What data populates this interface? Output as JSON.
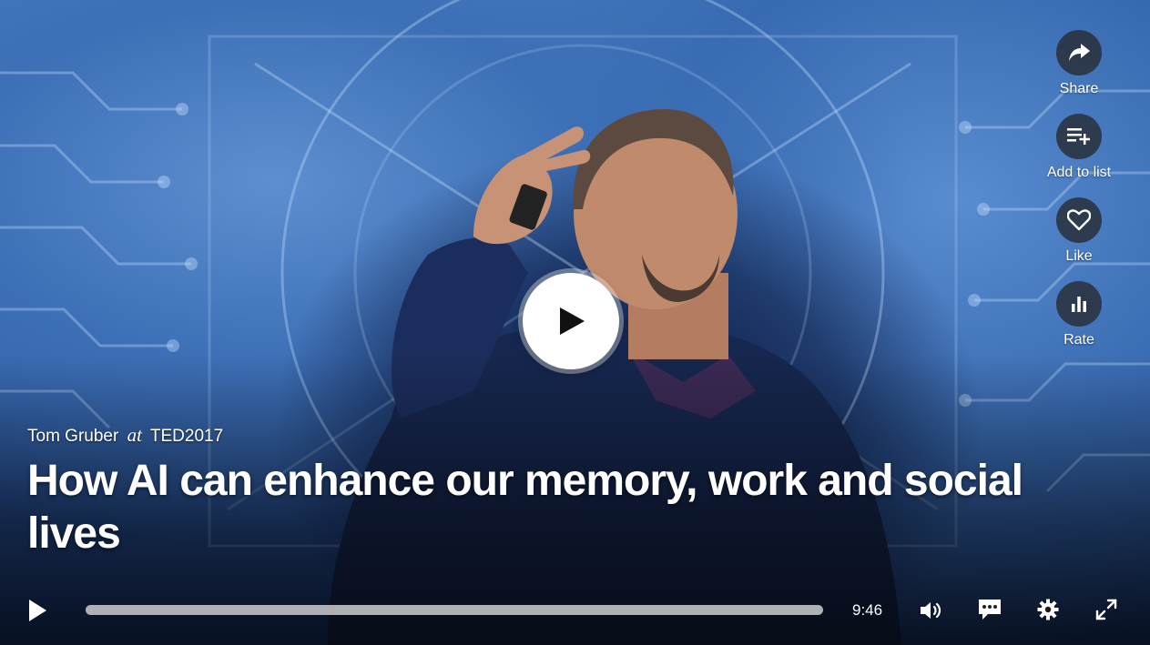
{
  "video": {
    "speaker": "Tom Gruber",
    "at_word": "at",
    "event": "TED2017",
    "title": "How AI can enhance our memory, work and social lives",
    "progress": 0
  },
  "side_actions": [
    {
      "label": "Share",
      "icon": "share-icon"
    },
    {
      "label": "Add to list",
      "icon": "add-to-list-icon"
    },
    {
      "label": "Like",
      "icon": "heart-icon"
    },
    {
      "label": "Rate",
      "icon": "bar-chart-icon"
    }
  ],
  "controls": {
    "duration": "9:46"
  },
  "colors": {
    "accent": "#e62b1e",
    "overlay_button": "#282c34",
    "text": "#ffffff"
  }
}
